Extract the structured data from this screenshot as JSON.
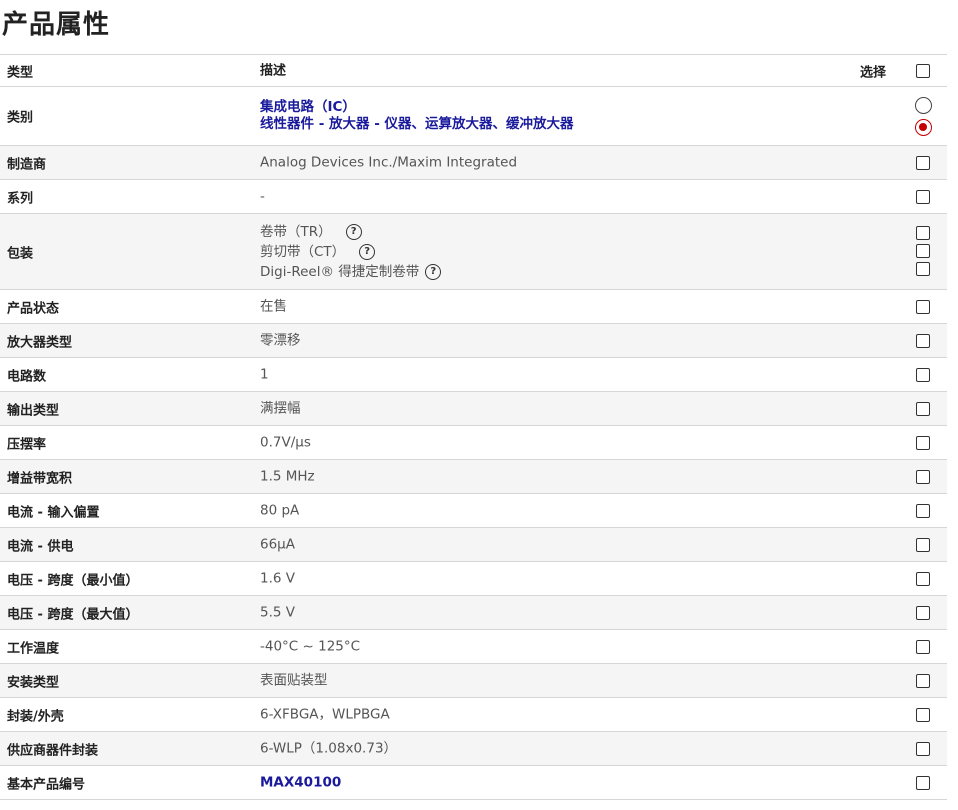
{
  "page": {
    "title": "产品属性"
  },
  "header": {
    "type": "类型",
    "desc": "描述",
    "select": "选择"
  },
  "rows": [
    {
      "type": "类别",
      "desc": [
        "集成电路（IC）",
        "线性器件 - 放大器 - 仪器、运算放大器、缓冲放大器"
      ]
    },
    {
      "type": "制造商",
      "desc": "Analog Devices Inc./Maxim Integrated"
    },
    {
      "type": "系列",
      "desc": "-"
    },
    {
      "type": "包装",
      "desc": [
        "卷带（TR）",
        "剪切带（CT）",
        "Digi-Reel® 得捷定制卷带"
      ]
    },
    {
      "type": "产品状态",
      "desc": "在售"
    },
    {
      "type": "放大器类型",
      "desc": "零漂移"
    },
    {
      "type": "电路数",
      "desc": "1"
    },
    {
      "type": "输出类型",
      "desc": "满摆幅"
    },
    {
      "type": "压摆率",
      "desc": "0.7V/µs"
    },
    {
      "type": "增益带宽积",
      "desc": "1.5 MHz"
    },
    {
      "type": "电流 - 输入偏置",
      "desc": "80 pA"
    },
    {
      "type": "电流 - 供电",
      "desc": "66µA"
    },
    {
      "type": "电压 - 跨度（最小值）",
      "desc": "1.6 V"
    },
    {
      "type": "电压 - 跨度（最大值）",
      "desc": "5.5 V"
    },
    {
      "type": "工作温度",
      "desc": "-40°C ~ 125°C"
    },
    {
      "type": "安装类型",
      "desc": "表面贴装型"
    },
    {
      "type": "封装/外壳",
      "desc": "6-XFBGA，WLPBGA"
    },
    {
      "type": "供应商器件封装",
      "desc": "6-WLP（1.08x0.73）"
    },
    {
      "type": "基本产品编号",
      "desc": "MAX40100"
    }
  ],
  "help_icon": "?",
  "category_radio_selected": 1,
  "colors": {
    "link": "#1a1a9c",
    "radio_checked": "#c40000",
    "row_alt": "#f5f5f5"
  }
}
